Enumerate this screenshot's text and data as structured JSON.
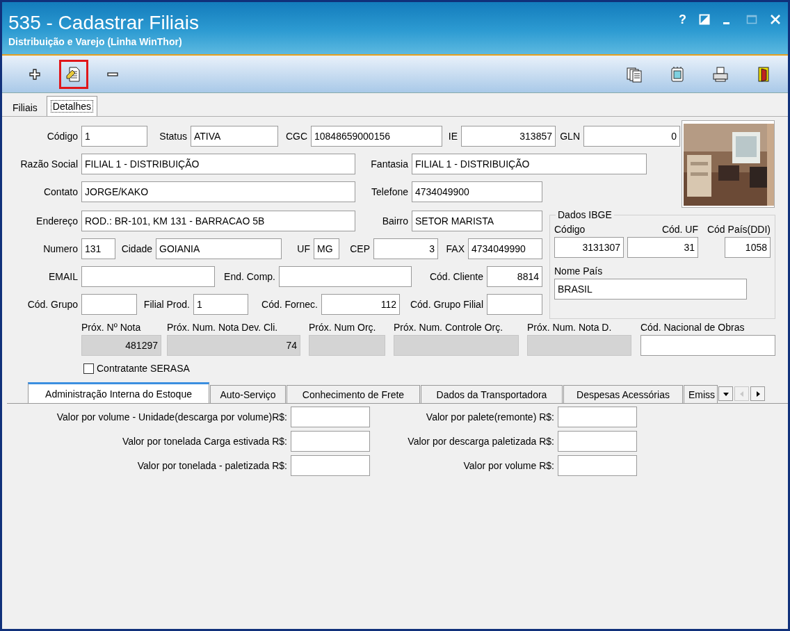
{
  "window": {
    "title": "535 - Cadastrar Filiais",
    "subtitle": "Distribuição e Varejo (Linha WinThor)"
  },
  "window_controls": [
    {
      "kind": "help",
      "label": "?",
      "disabled": false
    },
    {
      "kind": "restore",
      "disabled": false
    },
    {
      "kind": "minimize",
      "disabled": false
    },
    {
      "kind": "maximize",
      "disabled": true
    },
    {
      "kind": "close",
      "disabled": false
    }
  ],
  "toolbar": {
    "left": [
      {
        "kind": "add",
        "highlighted": false
      },
      {
        "kind": "edit",
        "highlighted": true
      },
      {
        "kind": "remove",
        "highlighted": false
      }
    ],
    "right": [
      {
        "kind": "copy",
        "highlighted": false
      },
      {
        "kind": "notes",
        "highlighted": false
      },
      {
        "kind": "print",
        "highlighted": false
      },
      {
        "kind": "exit",
        "highlighted": false
      }
    ]
  },
  "tabs": [
    {
      "label": "Filiais",
      "selected": false
    },
    {
      "label": "Detalhes",
      "selected": true
    }
  ],
  "form_rows": [
    [
      {
        "label": "Código",
        "value": "1"
      },
      {
        "label": "Status",
        "value": "ATIVA"
      },
      {
        "label": "CGC",
        "value": "10848659000156"
      },
      {
        "label": "IE",
        "value": "313857",
        "right_aligned": true
      },
      {
        "label": "GLN",
        "value": "0",
        "right_aligned": true
      }
    ],
    [
      {
        "label": "Razão Social",
        "value": "FILIAL 1 - DISTRIBUIÇÃO"
      },
      {
        "label": "Fantasia",
        "value": "FILIAL 1 - DISTRIBUIÇÃO"
      }
    ],
    [
      {
        "label": "Contato",
        "value": "JORGE/KAKO"
      },
      {
        "label": "Telefone",
        "value": "4734049900"
      }
    ],
    [
      {
        "label": "Endereço",
        "value": "ROD.: BR-101, KM 131 - BARRACAO 5B"
      },
      {
        "label": "Bairro",
        "value": "SETOR MARISTA"
      }
    ],
    [
      {
        "label": "Numero",
        "value": "131"
      },
      {
        "label": "Cidade",
        "value": "GOIANIA"
      },
      {
        "label": "UF",
        "value": "MG"
      },
      {
        "label": "CEP",
        "value": "3",
        "right_aligned": true
      },
      {
        "label": "FAX",
        "value": "4734049990"
      }
    ],
    [
      {
        "label": "EMAIL"
      },
      {
        "label": "End. Comp."
      },
      {
        "label": "Cód. Cliente",
        "value": "8814",
        "right_aligned": true
      }
    ],
    [
      {
        "label": "Cód. Grupo"
      },
      {
        "label": "Filial Prod.",
        "value": "1"
      },
      {
        "label": "Cód. Fornec.",
        "value": "112",
        "right_aligned": true
      },
      {
        "label": "Cód. Grupo Filial"
      }
    ]
  ],
  "ibge": {
    "title": "Dados IBGE",
    "fields": [
      {
        "label": "Código",
        "value": "3131307"
      },
      {
        "label": "Cód. UF",
        "value": "31"
      },
      {
        "label": "Cód País(DDI)",
        "value": "1058"
      }
    ],
    "country": {
      "label": "Nome País",
      "value": "BRASIL"
    }
  },
  "next_numbers": [
    {
      "label": "Próx. Nº Nota",
      "value": "481297",
      "disabled": true
    },
    {
      "label": "Próx. Num. Nota Dev. Cli.",
      "value": "74",
      "disabled": true
    },
    {
      "label": "Próx. Num Orç.",
      "disabled": true
    },
    {
      "label": "Próx. Num. Controle Orç.",
      "disabled": true
    },
    {
      "label": "Próx. Num. Nota D.",
      "disabled": true
    },
    {
      "label": "Cód. Nacional de Obras",
      "disabled": false
    }
  ],
  "serasa": {
    "label": "Contratante SERASA",
    "checked": false
  },
  "sub_tabs": [
    {
      "label": "Administração Interna do Estoque",
      "selected": true
    },
    {
      "label": "Auto-Serviço",
      "selected": false
    },
    {
      "label": "Conhecimento de Frete",
      "selected": false
    },
    {
      "label": "Dados da Transportadora",
      "selected": false
    },
    {
      "label": "Despesas Acessórias",
      "selected": false
    },
    {
      "label": "Emiss",
      "selected": false
    }
  ],
  "sub_tab_nav": [
    {
      "kind": "dropdown",
      "disabled": false
    },
    {
      "kind": "prev",
      "disabled": true
    },
    {
      "kind": "next",
      "disabled": false
    }
  ],
  "freight_fields": [
    {
      "label": "Valor por volume - Unidade(descarga por volume)R$:"
    },
    {
      "label": "Valor por palete(remonte) R$:"
    },
    {
      "label": "Valor por tonelada Carga estivada R$:"
    },
    {
      "label": "Valor por descarga paletizada R$:"
    },
    {
      "label": "Valor por tonelada - paletizada R$:"
    },
    {
      "label": "Valor por volume R$:"
    }
  ]
}
